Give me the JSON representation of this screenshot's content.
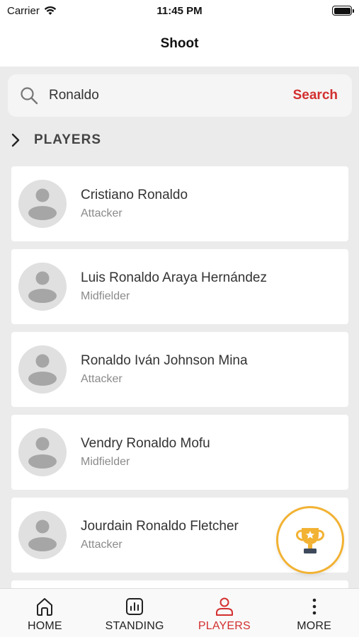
{
  "status_bar": {
    "carrier": "Carrier",
    "time": "11:45 PM"
  },
  "header": {
    "title": "Shoot"
  },
  "search": {
    "query": "Ronaldo",
    "button_label": "Search"
  },
  "section": {
    "title": "PLAYERS"
  },
  "players": [
    {
      "name": "Cristiano Ronaldo",
      "position": "Attacker"
    },
    {
      "name": "Luis Ronaldo Araya Hernández",
      "position": "Midfielder"
    },
    {
      "name": "Ronaldo Iván Johnson Mina",
      "position": "Attacker"
    },
    {
      "name": "Vendry Ronaldo Mofu",
      "position": "Midfielder"
    },
    {
      "name": "Jourdain Ronaldo Fletcher",
      "position": "Attacker"
    }
  ],
  "tab_bar": {
    "tabs": [
      {
        "label": "HOME",
        "icon": "home-icon"
      },
      {
        "label": "STANDING",
        "icon": "standing-icon"
      },
      {
        "label": "PLAYERS",
        "icon": "person-icon"
      },
      {
        "label": "MORE",
        "icon": "more-icon"
      }
    ],
    "active_tab": "PLAYERS"
  },
  "colors": {
    "accent": "#d32f2f",
    "trophy": "#f2b233",
    "background": "#ebebeb"
  }
}
